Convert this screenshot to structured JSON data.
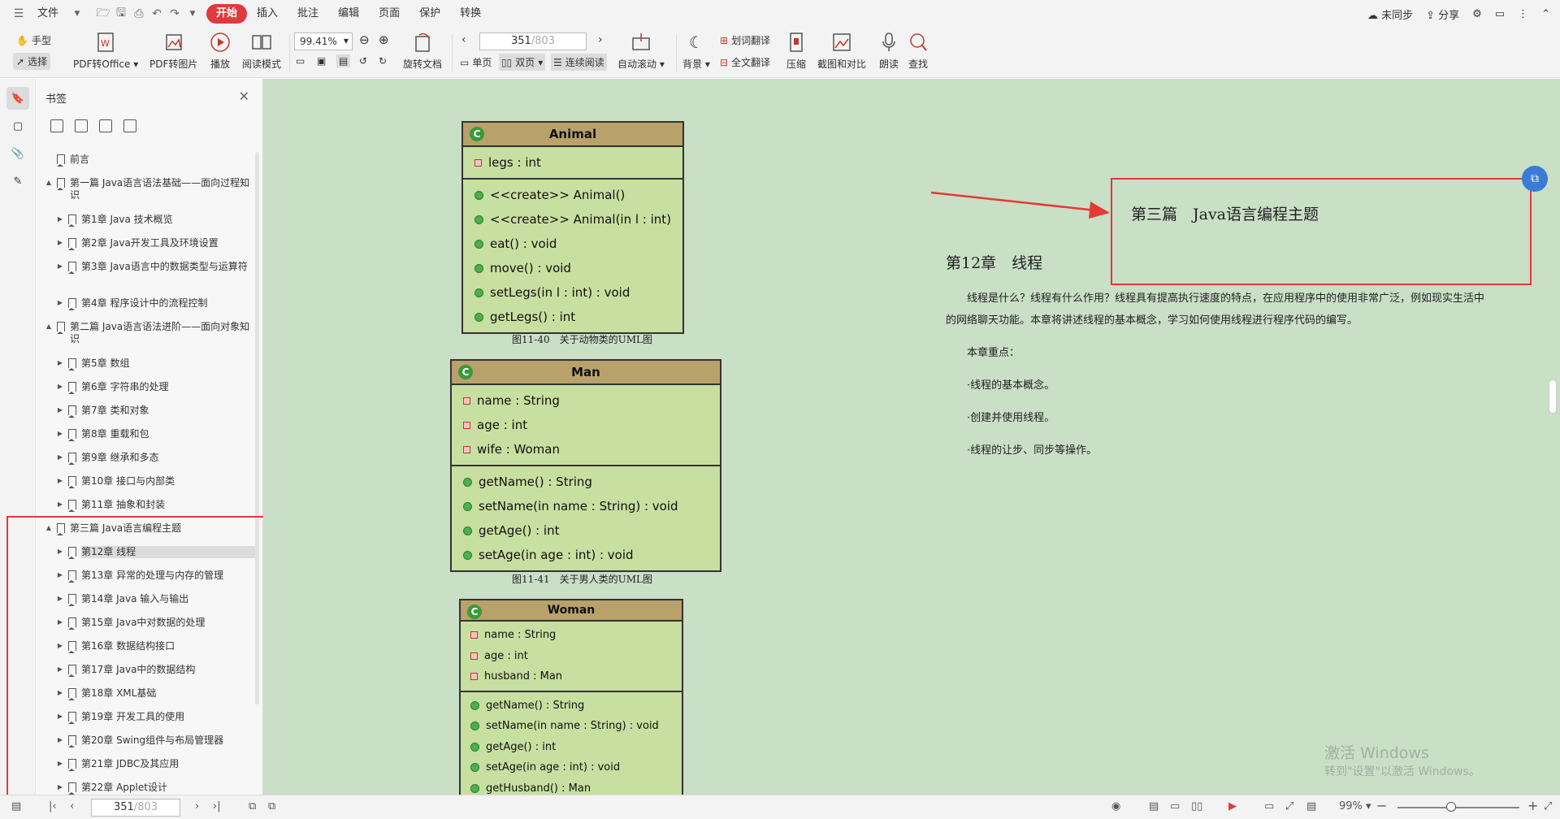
{
  "menubar": {
    "file": "文件",
    "items": [
      "开始",
      "插入",
      "批注",
      "编辑",
      "页面",
      "保护",
      "转换"
    ],
    "right": {
      "sync": "未同步",
      "share": "分享"
    }
  },
  "ribbon": {
    "hand": "手型",
    "select": "选择",
    "pdf_to_office": "PDF转Office",
    "pdf_to_image": "PDF转图片",
    "play": "播放",
    "read_mode": "阅读模式",
    "zoom_value": "99.41%",
    "rotate_doc": "旋转文档",
    "page_current": "351",
    "page_total": "/803",
    "single_page": "单页",
    "double_page": "双页",
    "continuous": "连续阅读",
    "auto_scroll": "自动滚动",
    "background": "背景",
    "word_translate": "划词翻译",
    "full_translate": "全文翻译",
    "compress": "压缩",
    "screenshot_compare": "截图和对比",
    "read_aloud": "朗读",
    "find": "查找"
  },
  "bookmarks": {
    "title": "书签",
    "items": [
      {
        "text": "前言",
        "arrow": "",
        "level": 0,
        "tall": false
      },
      {
        "text": "第一篇 Java语言语法基础——面向过程知识",
        "arrow": "▲",
        "level": 0,
        "tall": true
      },
      {
        "text": "第1章 Java 技术概览",
        "arrow": "▶",
        "level": 1,
        "tall": false
      },
      {
        "text": "第2章 Java开发工具及环境设置",
        "arrow": "▶",
        "level": 1,
        "tall": false
      },
      {
        "text": "第3章 Java语言中的数据类型与运算符",
        "arrow": "▶",
        "level": 1,
        "tall": true
      },
      {
        "text": "第4章 程序设计中的流程控制",
        "arrow": "▶",
        "level": 1,
        "tall": false
      },
      {
        "text": "第二篇 Java语言语法进阶——面向对象知识",
        "arrow": "▲",
        "level": 0,
        "tall": true
      },
      {
        "text": "第5章 数组",
        "arrow": "▶",
        "level": 1,
        "tall": false
      },
      {
        "text": "第6章 字符串的处理",
        "arrow": "▶",
        "level": 1,
        "tall": false
      },
      {
        "text": "第7章 类和对象",
        "arrow": "▶",
        "level": 1,
        "tall": false
      },
      {
        "text": "第8章 重载和包",
        "arrow": "▶",
        "level": 1,
        "tall": false
      },
      {
        "text": "第9章 继承和多态",
        "arrow": "▶",
        "level": 1,
        "tall": false
      },
      {
        "text": "第10章 接口与内部类",
        "arrow": "▶",
        "level": 1,
        "tall": false
      },
      {
        "text": "第11章 抽象和封装",
        "arrow": "▶",
        "level": 1,
        "tall": false
      },
      {
        "text": "第三篇 Java语言编程主题",
        "arrow": "▲",
        "level": 0,
        "tall": false
      },
      {
        "text": "第12章 线程",
        "arrow": "▶",
        "level": 1,
        "tall": false,
        "selected": true
      },
      {
        "text": "第13章 异常的处理与内存的管理",
        "arrow": "▶",
        "level": 1,
        "tall": false
      },
      {
        "text": "第14章 Java 输入与输出",
        "arrow": "▶",
        "level": 1,
        "tall": false
      },
      {
        "text": "第15章 Java中对数据的处理",
        "arrow": "▶",
        "level": 1,
        "tall": false
      },
      {
        "text": "第16章 数据结构接口",
        "arrow": "▶",
        "level": 1,
        "tall": false
      },
      {
        "text": "第17章 Java中的数据结构",
        "arrow": "▶",
        "level": 1,
        "tall": false
      },
      {
        "text": "第18章 XML基础",
        "arrow": "▶",
        "level": 1,
        "tall": false
      },
      {
        "text": "第19章 开发工具的使用",
        "arrow": "▶",
        "level": 1,
        "tall": false
      },
      {
        "text": "第20章 Swing组件与布局管理器",
        "arrow": "▶",
        "level": 1,
        "tall": false
      },
      {
        "text": "第21章 JDBC及其应用",
        "arrow": "▶",
        "level": 1,
        "tall": false
      },
      {
        "text": "第22章 Applet设计",
        "arrow": "▶",
        "level": 1,
        "tall": false
      }
    ]
  },
  "document": {
    "uml_animal": {
      "name": "Animal",
      "attributes": [
        "legs : int"
      ],
      "methods": [
        "<<create>> Animal()",
        "<<create>> Animal(in l : int)",
        "eat() : void",
        "move() : void",
        "setLegs(in l : int) : void",
        "getLegs() : int"
      ]
    },
    "caption1": "图11-40　关于动物类的UML图",
    "uml_man": {
      "name": "Man",
      "attributes": [
        "name : String",
        "age : int",
        "wife : Woman"
      ],
      "methods": [
        "getName() : String",
        "setName(in name : String) : void",
        "getAge() : int",
        "setAge(in age : int) : void"
      ]
    },
    "caption2": "图11-41　关于男人类的UML图",
    "uml_woman": {
      "name": "Woman",
      "attributes": [
        "name : String",
        "age : int",
        "husband : Man"
      ],
      "methods": [
        "getName() : String",
        "setName(in name : String) : void",
        "getAge() : int",
        "setAge(in age : int) : void",
        "getHusband() : Man"
      ]
    },
    "part_title": "第三篇　Java语言编程主题",
    "chapter_title": "第12章　线程",
    "intro_line1": "线程是什么？线程有什么作用？线程具有提高执行速度的特点，在应用程序中的使用非常广泛，例如现实生活中",
    "intro_line2": "的网络聊天功能。本章将讲述线程的基本概念，学习如何使用线程进行程序代码的编写。",
    "focus_title": "本章重点：",
    "focus_items": [
      "·线程的基本概念。",
      "·创建并使用线程。",
      "·线程的让步、同步等操作。"
    ],
    "watermark_line1": "激活 Windows",
    "watermark_line2": "转到\"设置\"以激活 Windows。"
  },
  "statusbar": {
    "page_current": "351",
    "page_total": "/803",
    "zoom": "99%"
  }
}
